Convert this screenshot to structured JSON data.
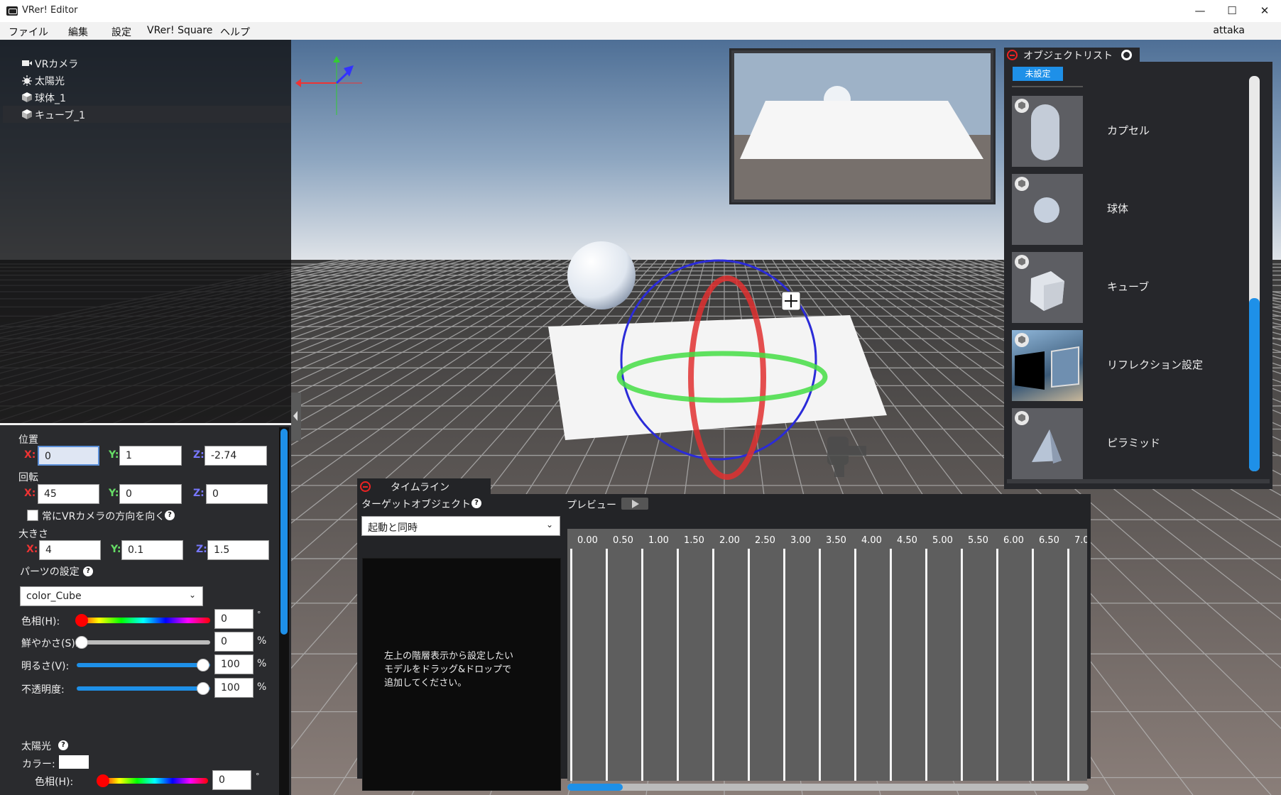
{
  "window": {
    "title": "VRer! Editor",
    "minimize": "—",
    "maximize": "☐",
    "close": "✕"
  },
  "menu": {
    "items": [
      "ファイル",
      "編集",
      "設定",
      "VRer! Square",
      "ヘルプ"
    ],
    "user": "attaka"
  },
  "hierarchy": {
    "items": [
      {
        "label": "VRカメラ",
        "icon": "video-camera-icon"
      },
      {
        "label": "太陽光",
        "icon": "sun-icon"
      },
      {
        "label": "球体_1",
        "icon": "cube-icon"
      },
      {
        "label": "キューブ_1",
        "icon": "cube-icon",
        "selected": true
      }
    ]
  },
  "inspector": {
    "position": {
      "label": "位置",
      "x": "0",
      "y": "1",
      "z": "-2.74"
    },
    "rotation": {
      "label": "回転",
      "x": "45",
      "y": "0",
      "z": "0"
    },
    "face_camera": {
      "label": "常にVRカメラの方向を向く",
      "checked": false
    },
    "scale": {
      "label": "大きさ",
      "x": "4",
      "y": "0.1",
      "z": "1.5"
    },
    "axes": {
      "x": "X:",
      "y": "Y:",
      "z": "Z:"
    },
    "parts": {
      "label": "パーツの設定",
      "selected": "color_Cube"
    },
    "hue": {
      "label": "色相(H):",
      "value": "0",
      "unit": "°",
      "level": 0
    },
    "saturation": {
      "label": "鮮やかさ(S):",
      "value": "0",
      "unit": "%",
      "level": 0
    },
    "brightness": {
      "label": "明るさ(V):",
      "value": "100",
      "unit": "%",
      "level": 1
    },
    "opacity": {
      "label": "不透明度:",
      "value": "100",
      "unit": "%",
      "level": 1
    },
    "sunlight": {
      "label": "太陽光",
      "color_label": "カラー:",
      "hue_label": "色相(H):",
      "hue_value": "0",
      "hue_unit": "°"
    }
  },
  "object_list": {
    "title": "オブジェクトリスト",
    "tab": "未設定",
    "items": [
      {
        "label": "カプセル"
      },
      {
        "label": "球体"
      },
      {
        "label": "キューブ"
      },
      {
        "label": "リフレクション設定"
      },
      {
        "label": "ピラミッド"
      }
    ]
  },
  "timeline": {
    "title": "タイムライン",
    "target_label": "ターゲットオブジェクト",
    "trigger": "起動と同時",
    "preview_label": "プレビュー",
    "drop_hint": [
      "左上の階層表示から設定したい",
      "モデルをドラッグ&ドロップで",
      "追加してください。"
    ],
    "ticks": [
      "0.00",
      "0.50",
      "1.00",
      "1.50",
      "2.00",
      "2.50",
      "3.00",
      "3.50",
      "4.00",
      "4.50",
      "5.00",
      "5.50",
      "6.00",
      "6.50",
      "7.0"
    ]
  },
  "colors": {
    "accent": "#1e90e8",
    "panel": "#26272b",
    "gizmo_x": "#e33",
    "gizmo_y": "#3c3",
    "gizmo_z": "#33f"
  }
}
